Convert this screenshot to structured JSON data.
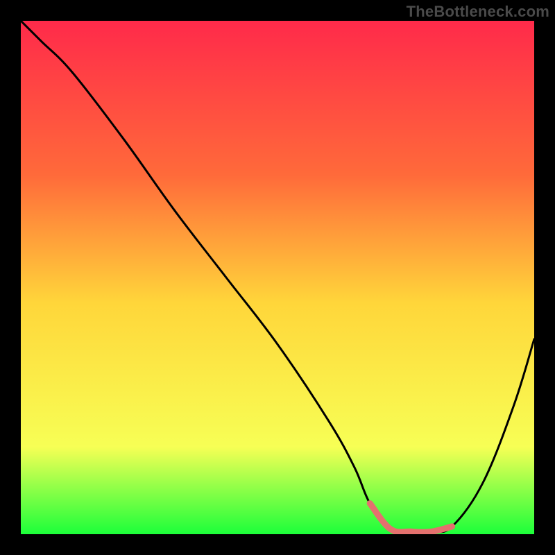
{
  "watermark": "TheBottleneck.com",
  "colors": {
    "gradient_top": "#ff2a4a",
    "gradient_q1": "#ff6a3a",
    "gradient_mid": "#ffd63a",
    "gradient_q3": "#f7ff55",
    "gradient_bottom": "#1cff3a",
    "curve": "#000000",
    "highlight": "#e4716e",
    "frame": "#000000"
  },
  "chart_data": {
    "type": "line",
    "title": "",
    "xlabel": "",
    "ylabel": "",
    "xlim": [
      0,
      100
    ],
    "ylim": [
      0,
      100
    ],
    "series": [
      {
        "name": "bottleneck-curve",
        "x": [
          0,
          4,
          10,
          20,
          30,
          40,
          50,
          60,
          65,
          68,
          72,
          76,
          80,
          84,
          90,
          96,
          100
        ],
        "y": [
          100,
          96,
          90,
          77,
          63,
          50,
          37,
          22,
          13,
          6,
          1,
          0.5,
          0.5,
          1.5,
          10,
          25,
          38
        ]
      }
    ],
    "highlight_segment": {
      "name": "optimal-range",
      "x": [
        68,
        72,
        76,
        80,
        84
      ],
      "y": [
        6,
        1,
        0.5,
        0.5,
        1.5
      ]
    }
  }
}
